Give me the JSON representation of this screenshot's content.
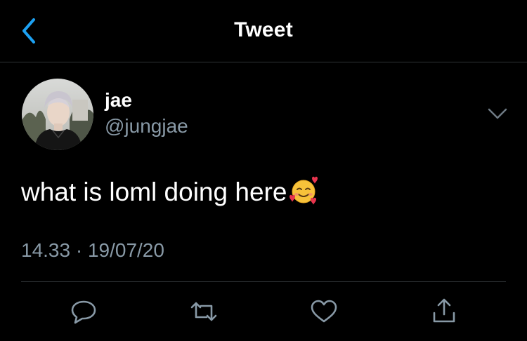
{
  "header": {
    "title": "Tweet",
    "back_icon": "chevron-left-icon"
  },
  "author": {
    "display_name": "jae",
    "handle": "@jungjae"
  },
  "tweet": {
    "text": "what is loml doing here",
    "emoji": "smiling-face-with-hearts",
    "timestamp": "14.33 · 19/07/20"
  },
  "actions": [
    {
      "icon": "reply-icon"
    },
    {
      "icon": "retweet-icon"
    },
    {
      "icon": "like-icon"
    },
    {
      "icon": "share-icon"
    }
  ],
  "colors": {
    "background": "#000000",
    "accent": "#1da1f2",
    "secondary_text": "#8899a6",
    "divider": "#2f3336"
  }
}
